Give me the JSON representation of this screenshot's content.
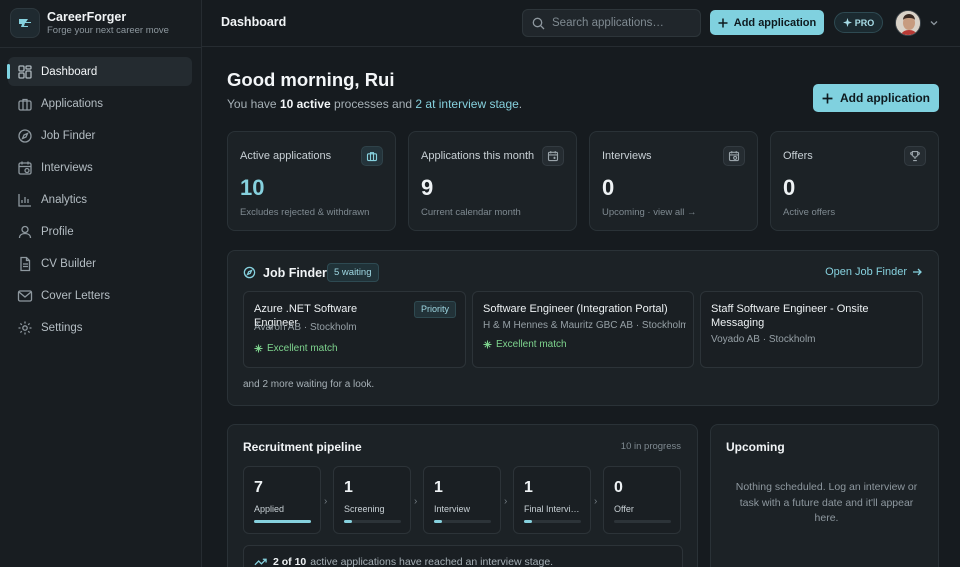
{
  "brand": {
    "name": "CareerForger",
    "tagline": "Forge your next career move"
  },
  "sidebar": {
    "items": [
      {
        "label": "Dashboard",
        "icon": "dashboard-icon",
        "active": true
      },
      {
        "label": "Applications",
        "icon": "briefcase-icon"
      },
      {
        "label": "Job Finder",
        "icon": "compass-icon"
      },
      {
        "label": "Interviews",
        "icon": "calendar-icon"
      },
      {
        "label": "Analytics",
        "icon": "bar-chart-icon"
      },
      {
        "label": "Profile",
        "icon": "user-icon"
      },
      {
        "label": "CV Builder",
        "icon": "document-icon"
      },
      {
        "label": "Cover Letters",
        "icon": "mail-icon"
      },
      {
        "label": "Settings",
        "icon": "gear-icon"
      }
    ]
  },
  "topbar": {
    "title": "Dashboard",
    "search_placeholder": "Search applications…",
    "add_label": "Add application",
    "pro_label": "PRO"
  },
  "greeting": {
    "title": "Good morning, Rui",
    "line_prefix": "You have",
    "active_count": "10 active",
    "line_mid": "processes and",
    "interview_link": "2 at interview stage",
    "line_end": ".",
    "add_label": "Add application"
  },
  "stats": [
    {
      "title": "Active applications",
      "value": "10",
      "sub": "Excludes rejected & withdrawn",
      "icon": "briefcase-icon"
    },
    {
      "title": "Applications this month",
      "value": "9",
      "sub": "Current calendar month",
      "icon": "calendar-plus-icon"
    },
    {
      "title": "Interviews",
      "value": "0",
      "sub": "Upcoming · view all →",
      "icon": "calendar-clock-icon"
    },
    {
      "title": "Offers",
      "value": "0",
      "sub": "Active offers",
      "icon": "trophy-icon"
    }
  ],
  "job_finder": {
    "title": "Job Finder",
    "badge": "5 waiting",
    "open_label": "Open Job Finder",
    "jobs": [
      {
        "title": "Azure .NET Software Engineer",
        "company": "Avaron AB · Stockholm",
        "match": "Excellent match",
        "priority": "Priority"
      },
      {
        "title": "Software Engineer (Integration Portal)",
        "company": "H & M Hennes & Mauritz GBC AB · Stockholm",
        "match": "Excellent match"
      },
      {
        "title": "Staff Software Engineer - Onsite Messaging",
        "company": "Voyado AB · Stockholm"
      }
    ],
    "more_text": "and 2 more waiting for a look."
  },
  "pipeline": {
    "title": "Recruitment pipeline",
    "count": "10 in progress",
    "stages": [
      {
        "value": "7",
        "label": "Applied",
        "progress": 1.0
      },
      {
        "value": "1",
        "label": "Screening",
        "progress": 0.14
      },
      {
        "value": "1",
        "label": "Interview",
        "progress": 0.14
      },
      {
        "value": "1",
        "label": "Final Interview",
        "progress": 0.14
      },
      {
        "value": "0",
        "label": "Offer",
        "progress": 0
      }
    ],
    "note_bold": "2 of 10",
    "note_text": "active applications have reached an interview stage."
  },
  "upcoming": {
    "title": "Upcoming",
    "empty_text": "Nothing scheduled. Log an interview or task with a future date and it'll appear here."
  },
  "colors": {
    "accent": "#80d1df",
    "match": "#7ed48e",
    "background": "#161b1f"
  }
}
